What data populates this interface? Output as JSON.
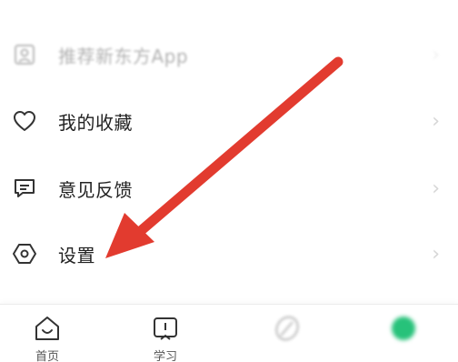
{
  "menu": {
    "items": [
      {
        "label": "推荐新东方App",
        "icon": "share-icon"
      },
      {
        "label": "我的收藏",
        "icon": "heart-icon"
      },
      {
        "label": "意见反馈",
        "icon": "message-icon"
      },
      {
        "label": "设置",
        "icon": "settings-hexagon-icon"
      }
    ]
  },
  "tabbar": {
    "tabs": [
      {
        "label": "首页",
        "icon": "home-icon"
      },
      {
        "label": "学习",
        "icon": "book-icon"
      },
      {
        "label": "",
        "icon": "leaf-icon"
      },
      {
        "label": "",
        "icon": "green-dot-icon"
      }
    ]
  },
  "colors": {
    "arrow": "#e23b2f",
    "icon_stroke": "#333333",
    "green_accent": "#27c27a"
  }
}
